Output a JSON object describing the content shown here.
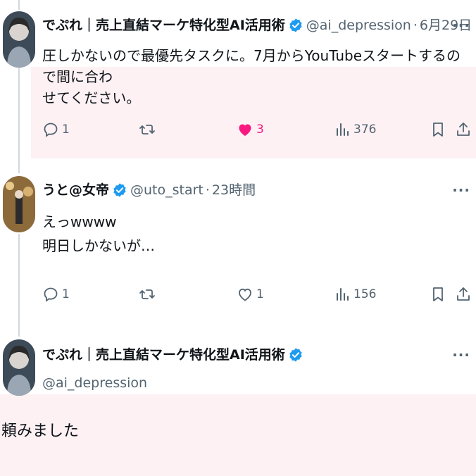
{
  "tweets": [
    {
      "author_name": "でぷれ｜売上直結マーケ特化型AI活用術",
      "handle": "@ai_depression",
      "separator": "·",
      "time": "6月29日",
      "text_line1": "圧しかないので最優先タスクに。7月からYouTubeスタートするので間に合わ",
      "text_line2": "せてください。",
      "replies": "1",
      "likes": "3",
      "views": "376",
      "liked": true
    },
    {
      "author_name": "うと@女帝",
      "handle": "@uto_start",
      "separator": "·",
      "time": "23時間",
      "text_line1": "えっwwww",
      "text_line2": "明日しかないが…",
      "replies": "1",
      "likes": "1",
      "views": "156",
      "liked": false
    },
    {
      "author_name": "でぷれ｜売上直結マーケ特化型AI活用術",
      "handle": "@ai_depression",
      "text": "頼みました"
    }
  ],
  "more_label": "···",
  "colors": {
    "text": "#0f1419",
    "secondary": "#536471",
    "like_pink": "#f91880",
    "verified_blue": "#1d9bf0",
    "highlight_bg": "#fdf1f4"
  },
  "icons": {
    "reply": "reply-icon",
    "retweet": "retweet-icon",
    "like": "heart-icon",
    "views": "views-icon",
    "bookmark": "bookmark-icon",
    "share": "share-icon",
    "verified": "verified-badge-icon",
    "more": "more-icon"
  }
}
